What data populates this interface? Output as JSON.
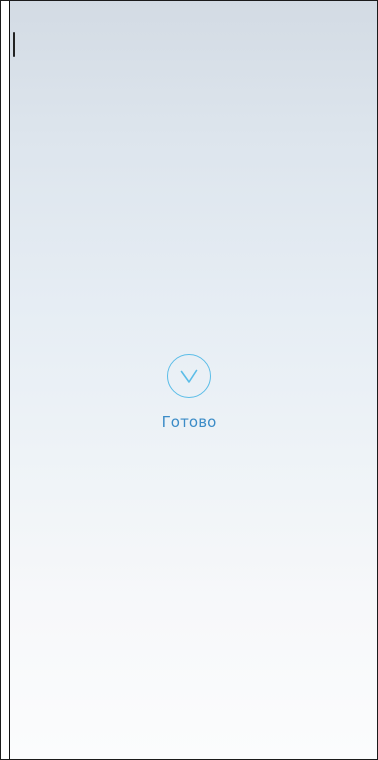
{
  "status": {
    "label": "Готово",
    "icon": "check-circle-icon",
    "accent": "#5BBDE8",
    "label_color": "#3B8CC7"
  },
  "theme": {
    "background_top": "#D3DBE4",
    "background_bottom": "#FBFCFD"
  }
}
